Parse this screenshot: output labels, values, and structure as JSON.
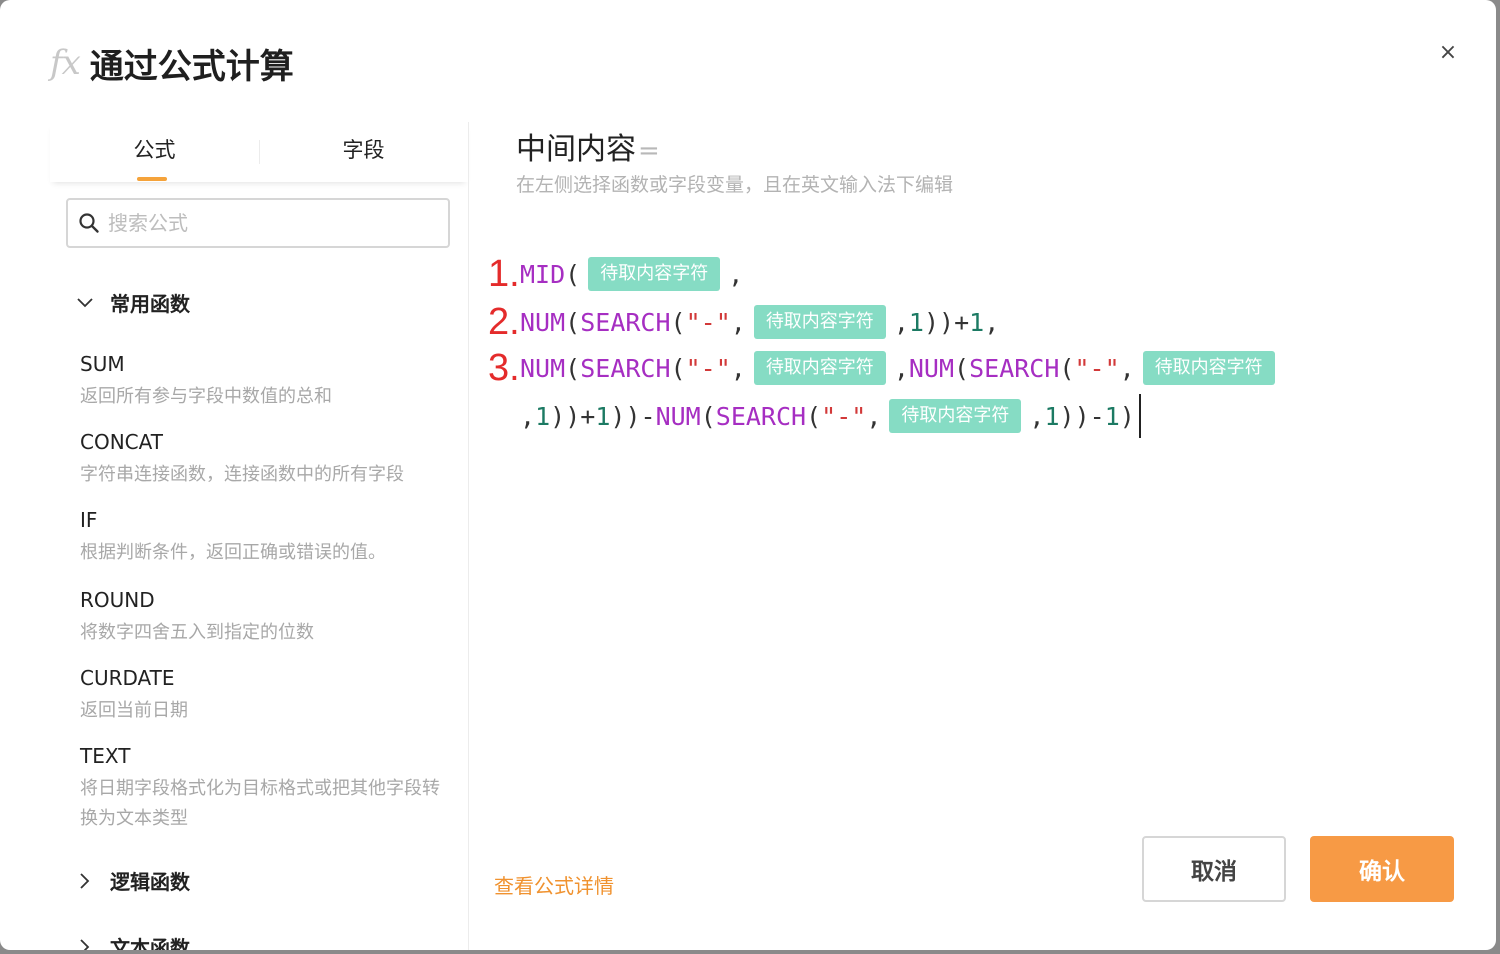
{
  "dialog": {
    "icon_text": "fx",
    "title": "通过公式计算",
    "close_symbol": "×"
  },
  "left_panel": {
    "tabs": [
      {
        "label": "公式",
        "active": true
      },
      {
        "label": "字段",
        "active": false
      }
    ],
    "search_placeholder": "搜索公式",
    "categories": [
      {
        "label": "常用函数",
        "expanded": true
      },
      {
        "label": "逻辑函数",
        "expanded": false
      },
      {
        "label": "文本函数",
        "expanded": false
      }
    ],
    "functions": [
      {
        "name": "SUM",
        "desc": "返回所有参与字段中数值的总和"
      },
      {
        "name": "CONCAT",
        "desc": "字符串连接函数，连接函数中的所有字段"
      },
      {
        "name": "IF",
        "desc": "根据判断条件，返回正确或错误的值。"
      },
      {
        "name": "ROUND",
        "desc": "将数字四舍五入到指定的位数"
      },
      {
        "name": "CURDATE",
        "desc": "返回当前日期"
      },
      {
        "name": "TEXT",
        "desc": "将日期字段格式化为目标格式或把其他字段转换为文本类型"
      }
    ]
  },
  "editor": {
    "field_name": "中间内容",
    "equals": "=",
    "hint": "在左侧选择函数或字段变量，且在英文输入法下编辑",
    "line_numbers": [
      "1.",
      "2.",
      "3."
    ],
    "field_pill": "待取内容字符",
    "tokens": {
      "mid": "MID",
      "num": "NUM",
      "search": "SEARCH",
      "lparen": "(",
      "rparen": ")",
      "comma": ",",
      "dash_str": "\"-\"",
      "one": "1",
      "plus": "+",
      "minus": "-"
    }
  },
  "footer": {
    "detail_link": "查看公式详情",
    "cancel_label": "取消",
    "confirm_label": "确认"
  },
  "colors": {
    "accent": "#f79a45",
    "tab_indicator": "#f5a33b",
    "pill": "#86dcc4",
    "function_token": "#a62ec2",
    "number_token": "#1c7a63",
    "string_token": "#d23939",
    "line_number": "#e42b2b"
  }
}
